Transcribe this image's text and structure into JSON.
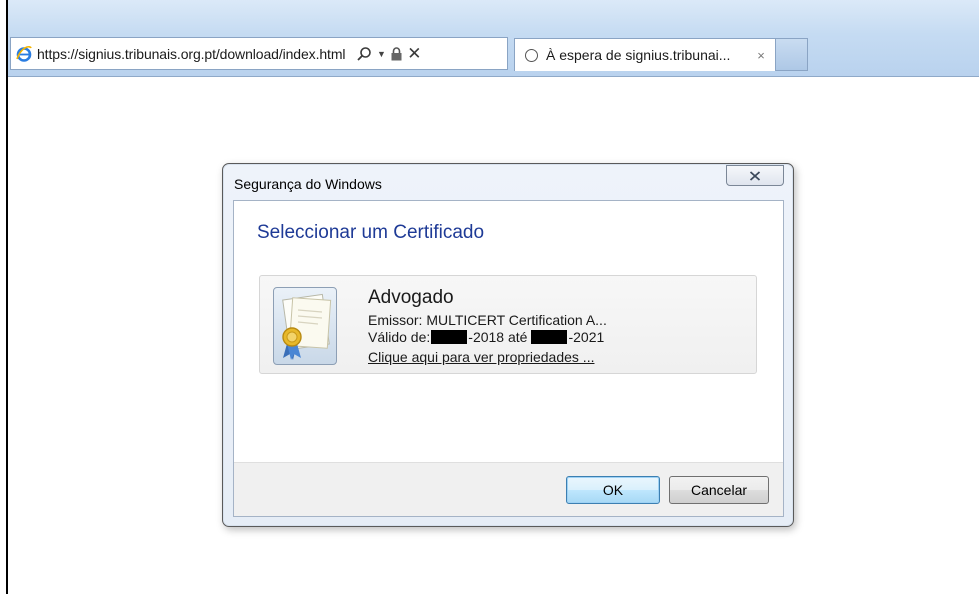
{
  "browser": {
    "url": "https://signius.tribunais.org.pt/download/index.html",
    "tab_title": "À espera de signius.tribunai...",
    "tab_close": "×",
    "address_close": "✕"
  },
  "dialog": {
    "title": "Segurança do Windows",
    "heading": "Seleccionar um Certificado",
    "certificate": {
      "name": "Advogado",
      "issuer": "Emissor: MULTICERT Certification A...",
      "valid_prefix": "Válido de:",
      "valid_from_suffix": "-2018 até",
      "valid_to_suffix": "-2021",
      "link": "Clique aqui para ver propriedades ..."
    },
    "buttons": {
      "ok": "OK",
      "cancel": "Cancelar"
    }
  },
  "icons": {
    "browser": "internet-explorer-icon",
    "search": "search-icon",
    "dropdown": "chevron-down-icon",
    "lock": "lock-icon",
    "loading": "loading-spinner-icon",
    "certificate": "certificate-icon",
    "close": "close-icon"
  },
  "colors": {
    "heading": "#1e3a96",
    "ok_border": "#3c7fb1"
  }
}
